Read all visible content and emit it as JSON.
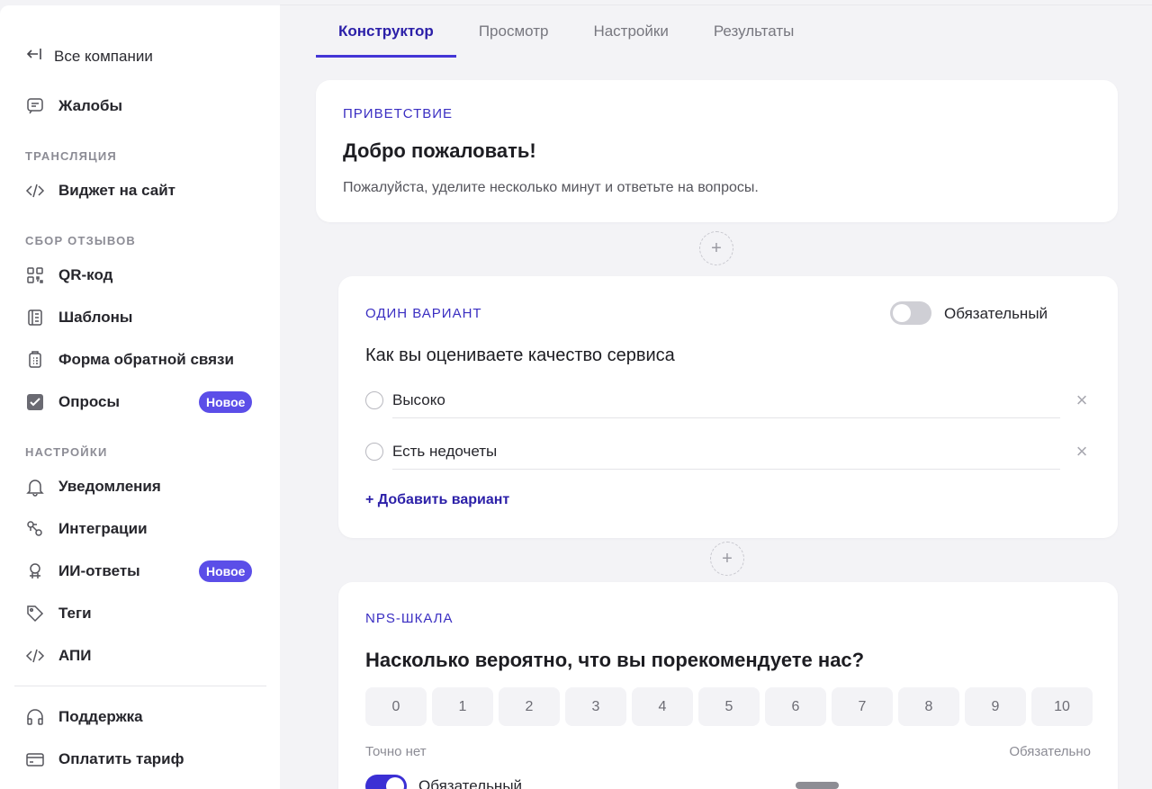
{
  "sidebar": {
    "back_label": "Все компании",
    "complaints": "Жалобы",
    "section_broadcast": "ТРАНСЛЯЦИЯ",
    "widget": "Виджет на сайт",
    "section_reviews": "СБОР ОТЗЫВОВ",
    "qr": "QR-код",
    "templates": "Шаблоны",
    "feedback_form": "Форма обратной связи",
    "surveys": "Опросы",
    "surveys_badge": "Новое",
    "section_settings": "НАСТРОЙКИ",
    "notifications": "Уведомления",
    "integrations": "Интеграции",
    "ai_replies": "ИИ-ответы",
    "ai_badge": "Новое",
    "tags": "Теги",
    "api": "АПИ",
    "support": "Поддержка",
    "pay": "Оплатить тариф"
  },
  "tabs": [
    "Конструктор",
    "Просмотр",
    "Настройки",
    "Результаты"
  ],
  "welcome": {
    "type": "ПРИВЕТСТВИЕ",
    "title": "Добро пожаловать!",
    "text": "Пожалуйста, уделите несколько минут и ответьте на вопросы."
  },
  "single_choice": {
    "type": "ОДИН ВАРИАНТ",
    "required_label": "Обязательный",
    "required": false,
    "question": "Как вы оцениваете качество сервиса",
    "options": [
      "Высоко",
      "Есть недочеты"
    ],
    "add_option": "+ Добавить вариант"
  },
  "nps": {
    "type": "NPS-ШКАЛА",
    "question": "Насколько вероятно, что вы порекомендуете нас?",
    "scale": [
      "0",
      "1",
      "2",
      "3",
      "4",
      "5",
      "6",
      "7",
      "8",
      "9",
      "10"
    ],
    "low_label": "Точно нет",
    "high_label": "Обязательно",
    "required_label": "Обязательный",
    "required": true
  },
  "add_icon": "+",
  "close_icon": "×",
  "colors": {
    "accent": "#3b2fd4",
    "badge": "#5b4ee8",
    "type_label": "#3a2ec2"
  }
}
